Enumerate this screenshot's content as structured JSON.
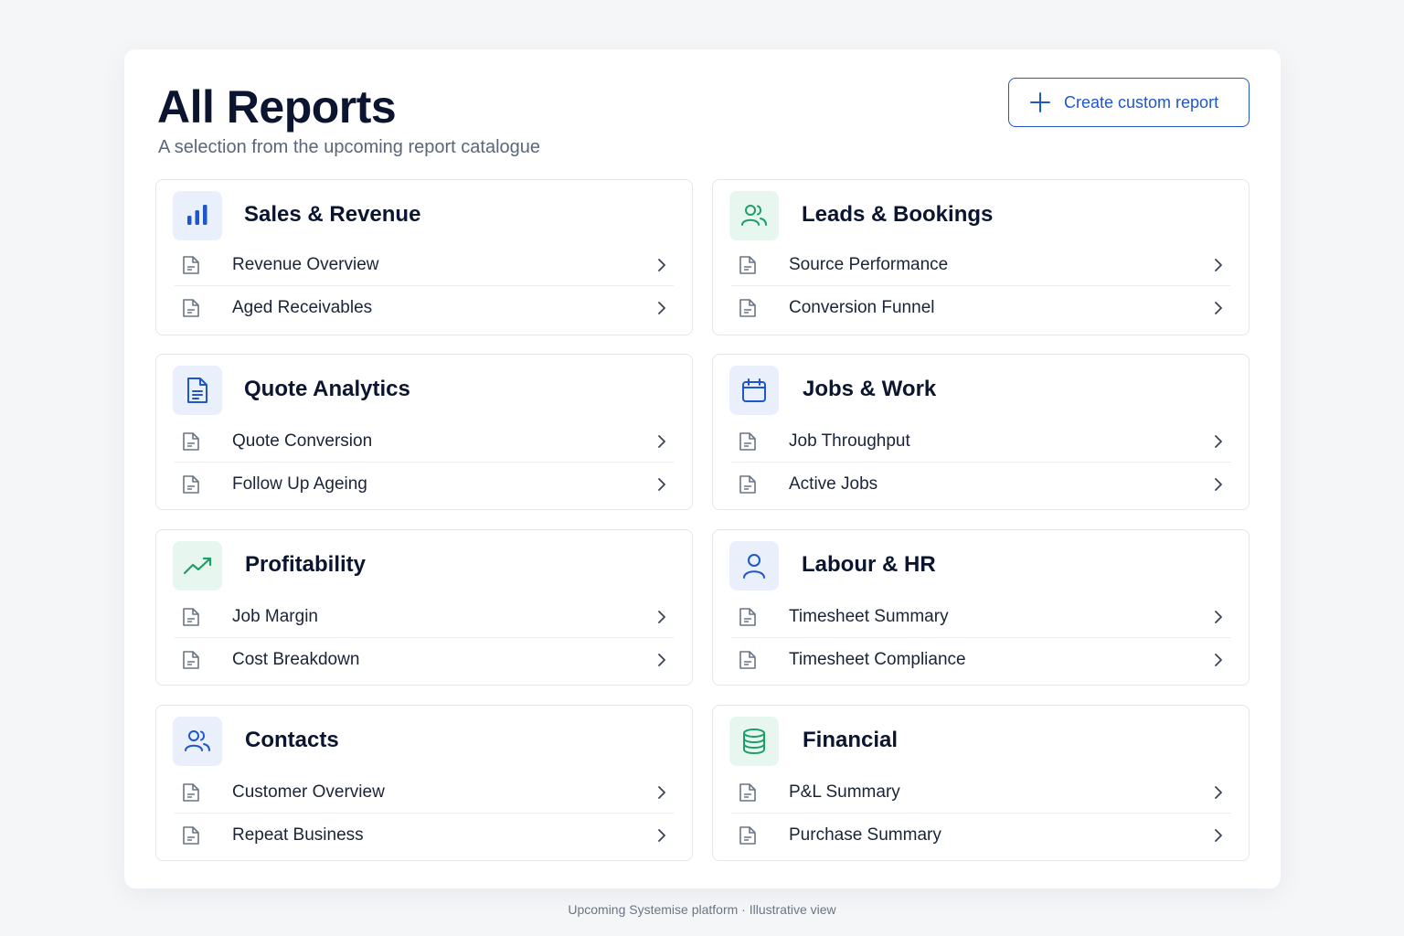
{
  "header": {
    "title": "All Reports",
    "subtitle": "A selection from the upcoming report catalogue",
    "create_button_label": "Create custom report"
  },
  "categories": [
    {
      "title": "Sales & Revenue",
      "icon": "bar-chart-icon",
      "color": "#1f56c9",
      "reports": [
        "Revenue Overview",
        "Aged Receivables"
      ]
    },
    {
      "title": "Leads & Bookings",
      "icon": "users-icon",
      "color": "#1e9e6a",
      "reports": [
        "Source Performance",
        "Conversion Funnel"
      ]
    },
    {
      "title": "Quote Analytics",
      "icon": "document-icon",
      "color": "#1f56c9",
      "reports": [
        "Quote Conversion",
        "Follow Up Ageing"
      ]
    },
    {
      "title": "Jobs & Work",
      "icon": "calendar-icon",
      "color": "#1f56c9",
      "reports": [
        "Job Throughput",
        "Active Jobs"
      ]
    },
    {
      "title": "Profitability",
      "icon": "trend-up-icon",
      "color": "#1e9e6a",
      "reports": [
        "Job Margin",
        "Cost Breakdown"
      ]
    },
    {
      "title": "Labour & HR",
      "icon": "user-icon",
      "color": "#1f56c9",
      "reports": [
        "Timesheet Summary",
        "Timesheet Compliance"
      ]
    },
    {
      "title": "Contacts",
      "icon": "users-icon",
      "color": "#1f56c9",
      "reports": [
        "Customer Overview",
        "Repeat Business"
      ]
    },
    {
      "title": "Financial",
      "icon": "database-icon",
      "color": "#1e9e6a",
      "reports": [
        "P&L Summary",
        "Purchase Summary"
      ]
    }
  ],
  "footer": "Upcoming Systemise platform · Illustrative view"
}
